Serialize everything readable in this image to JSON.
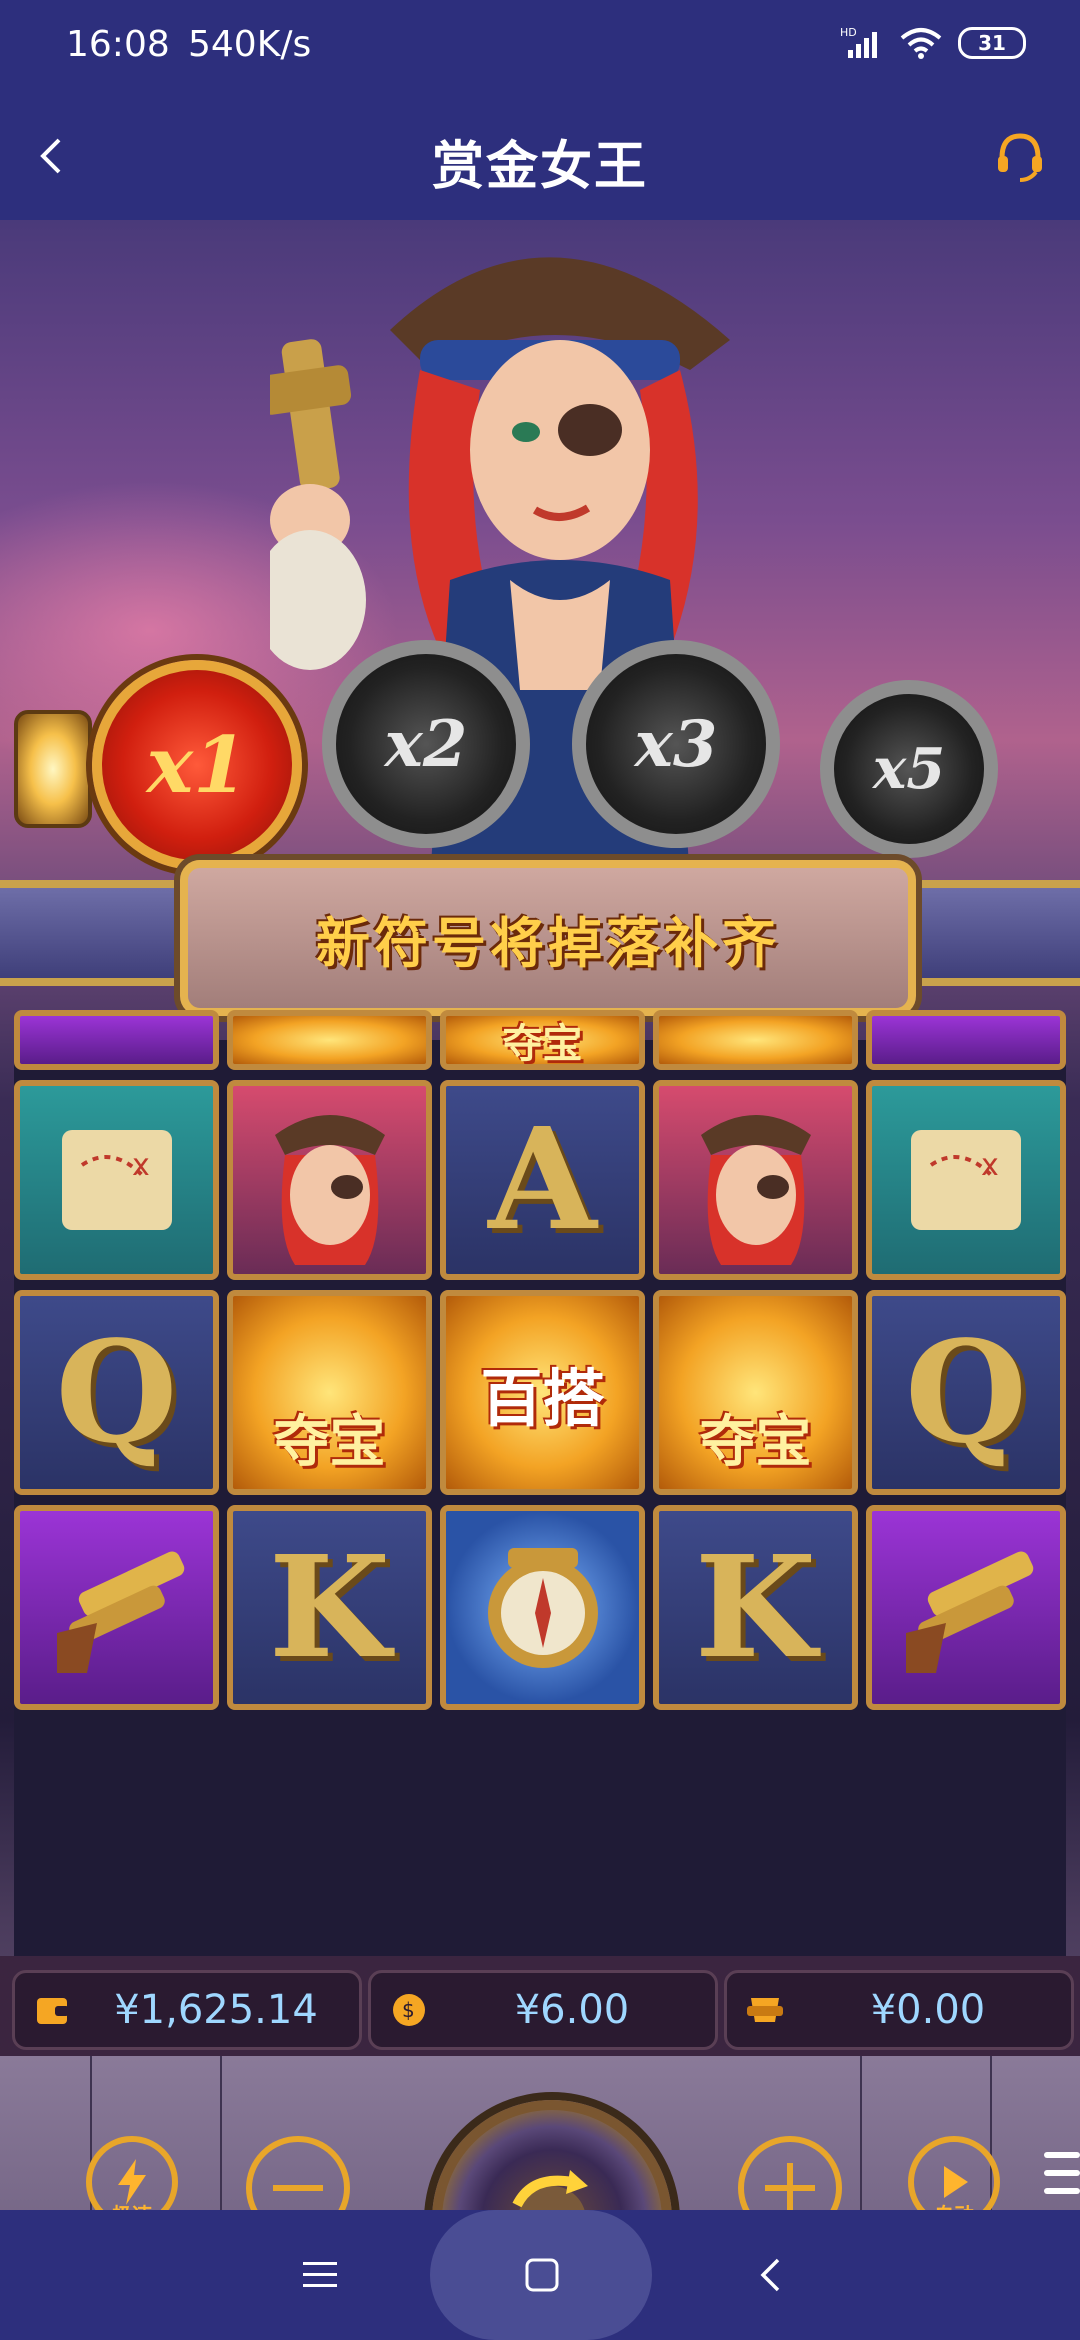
{
  "status_bar": {
    "time": "16:08",
    "speed": "540K/s",
    "network": "HD",
    "battery": "31"
  },
  "header": {
    "title": "赏金女王",
    "back_icon": "chevron-left-icon",
    "support_icon": "headset-icon"
  },
  "multipliers": [
    "x1",
    "x2",
    "x3",
    "x5"
  ],
  "banner_text": "新符号将掉落补齐",
  "reels": {
    "top_partial": [
      "夺宝",
      "夺宝"
    ],
    "rows": [
      [
        "map",
        "pirate-lady",
        "A",
        "pirate-lady",
        "map"
      ],
      [
        "Q",
        "夺宝",
        "百搭",
        "夺宝",
        "Q"
      ],
      [
        "pistol",
        "K",
        "compass",
        "K",
        "pistol"
      ]
    ]
  },
  "balances": {
    "wallet": "¥1,625.14",
    "bet": "¥6.00",
    "win": "¥0.00"
  },
  "controls": {
    "turbo_label": "极速",
    "auto_label": "自动"
  },
  "colors": {
    "accent": "#e8a62a",
    "bar": "#2d2f7d",
    "balance_text": "#9fd7ff"
  }
}
